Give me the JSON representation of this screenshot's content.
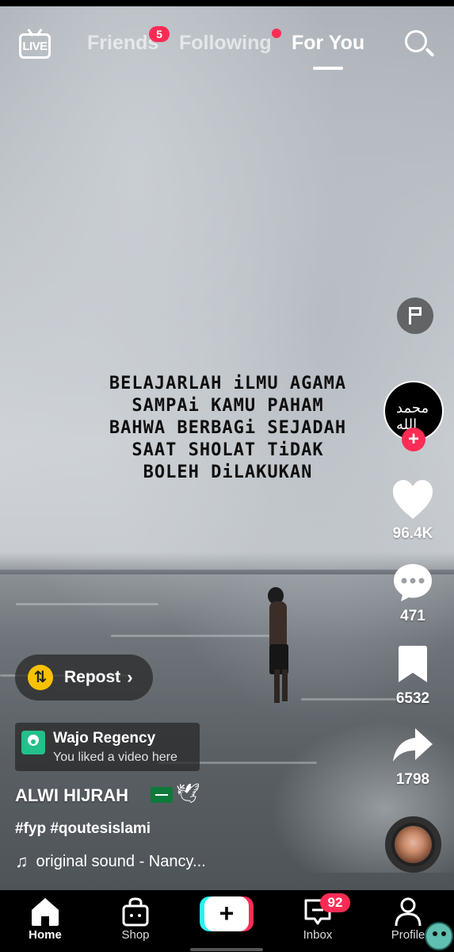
{
  "top_nav": {
    "live_label": "LIVE",
    "tabs": [
      {
        "label": "Friends",
        "badge": "5"
      },
      {
        "label": "Following"
      },
      {
        "label": "For You",
        "active": true
      }
    ]
  },
  "video": {
    "caption": "BELAJARLAH iLMU AGAMA\nSAMPAi KAMU PAHAM\nBAHWA BERBAGi SEJADAH\nSAAT SHOLAT TiDAK\nBOLEH DiLAKUKAN",
    "creator_avatar_text": "محمد الله"
  },
  "actions": {
    "likes": "96.4K",
    "comments": "471",
    "saves": "6532",
    "shares": "1798"
  },
  "repost": {
    "label": "Repost"
  },
  "location": {
    "name": "Wajo Regency",
    "subtitle": "You liked a video here"
  },
  "post": {
    "username": "ALWI HIJRAH",
    "hashtags": "#fyp #qoutesislami",
    "sound": "original sound - Nancy..."
  },
  "bottom_nav": {
    "items": [
      {
        "label": "Home",
        "icon": "home-icon",
        "active": true
      },
      {
        "label": "Shop",
        "icon": "shop-icon"
      },
      {
        "label": "",
        "icon": "plus-icon"
      },
      {
        "label": "Inbox",
        "icon": "inbox-icon",
        "badge": "92"
      },
      {
        "label": "Profile",
        "icon": "profile-icon"
      }
    ]
  },
  "colors": {
    "accent": "#fe2c55",
    "cyan": "#25f4ee",
    "repost": "#f8c200",
    "location": "#23c08b"
  }
}
